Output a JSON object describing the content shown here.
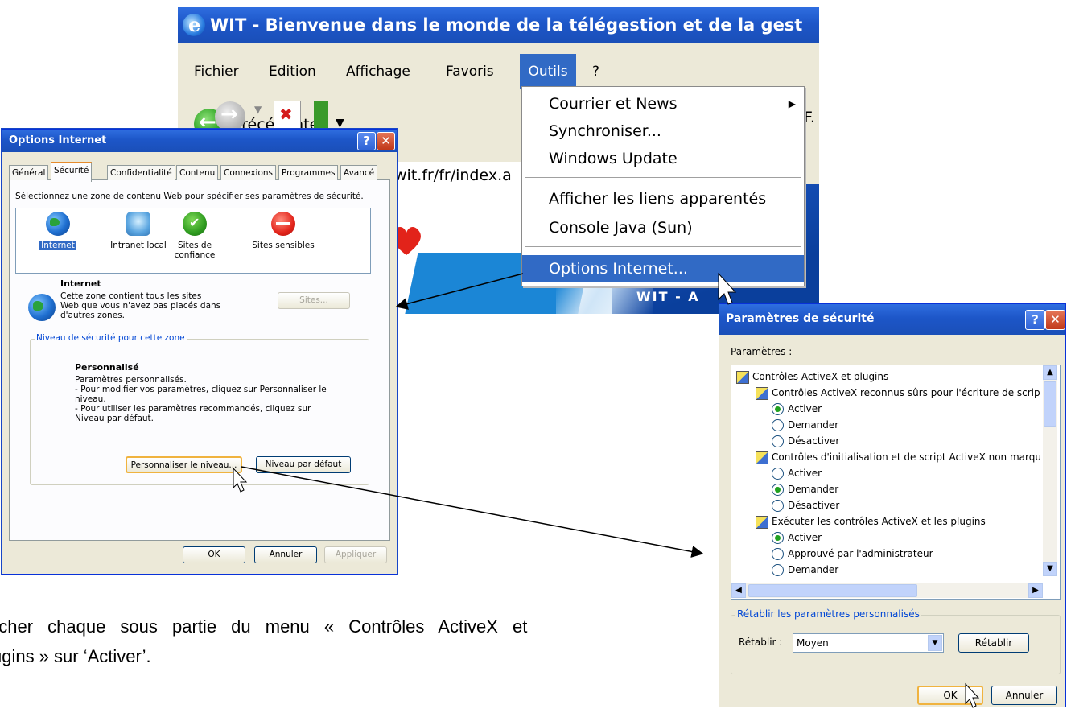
{
  "ie_window": {
    "title": "WIT - Bienvenue dans le monde de la télégestion et de la gest",
    "menu": [
      "Fichier",
      "Edition",
      "Affichage",
      "Favoris",
      "Outils",
      "?"
    ],
    "active_menu": "Outils",
    "toolbar": {
      "back_label": "Précédente",
      "fav_partial": "F."
    },
    "address": "wit.fr/fr/index.a",
    "page_partial_text": "WIT - A"
  },
  "tools_menu": {
    "items": [
      "Courrier et News",
      "Synchroniser...",
      "Windows Update",
      "Afficher les liens apparentés",
      "Console Java (Sun)",
      "Options Internet..."
    ],
    "highlighted": "Options Internet..."
  },
  "options_internet": {
    "title": "Options Internet",
    "tabs": [
      "Général",
      "Sécurité",
      "Confidentialité",
      "Contenu",
      "Connexions",
      "Programmes",
      "Avancé"
    ],
    "selected_tab": "Sécurité",
    "instruction": "Sélectionnez une zone de contenu Web pour spécifier ses paramètres de sécurité.",
    "zones": [
      {
        "label": "Internet",
        "icon": "globe-icon",
        "selected": true
      },
      {
        "label": "Intranet local",
        "icon": "intranet-icon",
        "selected": false
      },
      {
        "label": "Sites de\nconfiance",
        "icon": "trusted-check-icon",
        "selected": false
      },
      {
        "label": "Sites sensibles",
        "icon": "restricted-icon",
        "selected": false
      }
    ],
    "zone_name": "Internet",
    "zone_description": "Cette zone contient tous les sites Web que vous n'avez pas placés dans d'autres zones.",
    "sites_button": "Sites...",
    "level_group_title": "Niveau de sécurité pour cette zone",
    "level_name": "Personnalisé",
    "level_description": "Paramètres personnalisés.\n- Pour modifier vos paramètres, cliquez sur Personnaliser le niveau.\n- Pour utiliser les paramètres recommandés, cliquez sur Niveau par défaut.",
    "custom_level_button": "Personnaliser le niveau...",
    "default_level_button": "Niveau par défaut",
    "ok": "OK",
    "cancel": "Annuler",
    "apply": "Appliquer"
  },
  "security_settings": {
    "title": "Paramètres de sécurité",
    "params_label": "Paramètres :",
    "tree": [
      {
        "type": "group",
        "level": 0,
        "label": "Contrôles ActiveX et plugins"
      },
      {
        "type": "group",
        "level": 1,
        "label": "Contrôles ActiveX reconnus sûrs pour l'écriture de scrip"
      },
      {
        "type": "radio",
        "level": 2,
        "label": "Activer",
        "checked": true
      },
      {
        "type": "radio",
        "level": 2,
        "label": "Demander",
        "checked": false
      },
      {
        "type": "radio",
        "level": 2,
        "label": "Désactiver",
        "checked": false
      },
      {
        "type": "group",
        "level": 1,
        "label": "Contrôles d'initialisation et de script ActiveX non marqu"
      },
      {
        "type": "radio",
        "level": 2,
        "label": "Activer",
        "checked": false
      },
      {
        "type": "radio",
        "level": 2,
        "label": "Demander",
        "checked": true
      },
      {
        "type": "radio",
        "level": 2,
        "label": "Désactiver",
        "checked": false
      },
      {
        "type": "group",
        "level": 1,
        "label": "Exécuter les contrôles ActiveX et les plugins"
      },
      {
        "type": "radio",
        "level": 2,
        "label": "Activer",
        "checked": true
      },
      {
        "type": "radio",
        "level": 2,
        "label": "Approuvé par l'administrateur",
        "checked": false
      },
      {
        "type": "radio",
        "level": 2,
        "label": "Demander",
        "checked": false
      }
    ],
    "reset_group_title": "Rétablir les paramètres personnalisés",
    "reset_label": "Rétablir :",
    "reset_value": "Moyen",
    "reset_button": "Rétablir",
    "ok": "OK",
    "cancel": "Annuler"
  },
  "caption": {
    "line1": "ocher chaque sous partie du menu « Contrôles ActiveX et",
    "line2": "ugins » sur ‘Activer’."
  },
  "colors": {
    "xp_title_blue": "#1d56c8",
    "menu_highlight": "#316ac5",
    "dialog_bg": "#ece9d8"
  }
}
